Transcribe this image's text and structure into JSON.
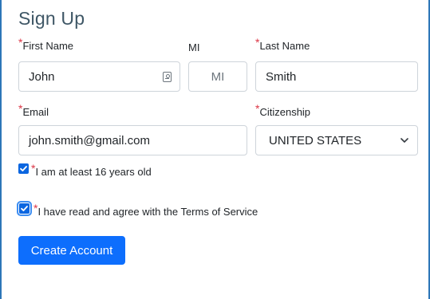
{
  "form": {
    "title": "Sign Up",
    "required_marker": "*",
    "first_name": {
      "label": "First Name",
      "value": "John"
    },
    "mi": {
      "label": "MI",
      "placeholder": "MI"
    },
    "last_name": {
      "label": "Last Name",
      "value": "Smith"
    },
    "email": {
      "label": "Email",
      "value": "john.smith@gmail.com"
    },
    "citizenship": {
      "label": "Citizenship",
      "selected": "UNITED STATES"
    },
    "age_check": {
      "label": "I am at least 16 years old",
      "checked": true
    },
    "terms_check": {
      "label": "I have read and agree with the Terms of Service",
      "checked": true
    },
    "submit_label": "Create Account"
  },
  "icons": {
    "autofill": "contact-card-icon",
    "dropdown": "chevron-down-icon",
    "check": "checkmark-icon"
  },
  "colors": {
    "required": "#dc3545",
    "accent": "#0d6efd",
    "frame": "#2d76b8",
    "title": "#3f5766"
  }
}
